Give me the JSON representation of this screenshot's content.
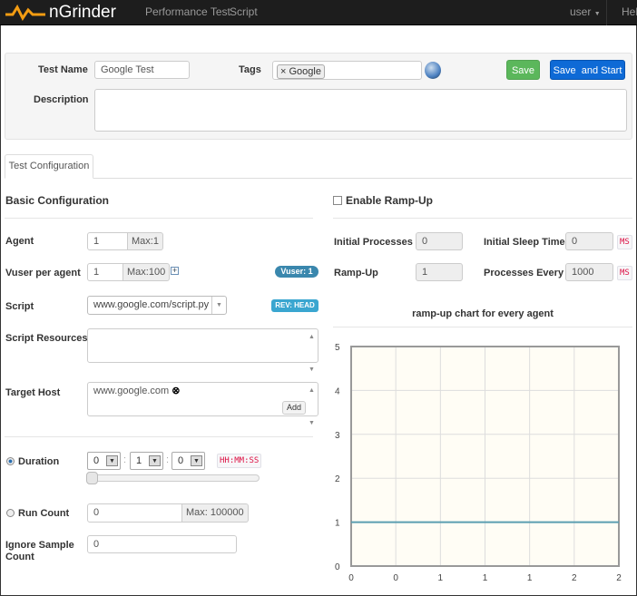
{
  "nav": {
    "brand": "nGrinder",
    "links": [
      "Performance Test",
      "Script"
    ],
    "user": "user",
    "help": "Hel"
  },
  "header": {
    "test_name_label": "Test Name",
    "test_name_value": "Google Test",
    "tags_label": "Tags",
    "tags": [
      "Google"
    ],
    "save": "Save",
    "save_start": "Save  and Start",
    "description_label": "Description",
    "description_value": ""
  },
  "tabs": [
    "Test Configuration"
  ],
  "basic": {
    "title": "Basic Configuration",
    "agent_label": "Agent",
    "agent_value": "1",
    "agent_max": "Max:1",
    "vuser_label": "Vuser per agent",
    "vuser_value": "1",
    "vuser_max": "Max:100",
    "vuser_badge": "Vuser: 1",
    "script_label": "Script",
    "script_value": "www.google.com/script.py",
    "rev_badge": "REV: HEAD",
    "resources_label": "Script Resources",
    "target_label": "Target Host",
    "target_value": "www.google.com",
    "add": "Add",
    "duration_label": "Duration",
    "duration": {
      "h": "0",
      "m": "1",
      "s": "0"
    },
    "duration_format": "HH:MM:SS",
    "duration_slider": 0,
    "duration_selected": true,
    "runcount_label": "Run Count",
    "runcount_value": "0",
    "runcount_max": "Max: 100000",
    "ignore_label_1": "Ignore Sample",
    "ignore_label_2": "Count",
    "ignore_value": "0"
  },
  "ramp": {
    "enable_label": "Enable Ramp-Up",
    "enabled": false,
    "init_proc_label": "Initial Processes",
    "init_proc": "0",
    "init_sleep_label": "Initial Sleep Time",
    "init_sleep": "0",
    "ms": "MS",
    "rampup_label": "Ramp-Up",
    "rampup": "1",
    "every_label": "Processes Every",
    "every": "1000"
  },
  "chart_data": {
    "type": "line",
    "title": "ramp-up chart for every agent",
    "ylim": [
      0,
      5
    ],
    "yticks": [
      "0",
      "1",
      "2",
      "3",
      "4",
      "5"
    ],
    "xticks": [
      "0",
      "0",
      "1",
      "1",
      "1",
      "2",
      "2"
    ],
    "series": [
      {
        "values": [
          1,
          1
        ],
        "x": [
          0,
          2
        ]
      }
    ],
    "grid": true,
    "colors": {
      "line": "#5b9eb0",
      "background": "#fffdf5"
    }
  },
  "colors": {
    "save": "#5bb75b",
    "save_start": "#0e6ad6",
    "badge": "#3a87ad",
    "nav": "#1d1d1d"
  }
}
